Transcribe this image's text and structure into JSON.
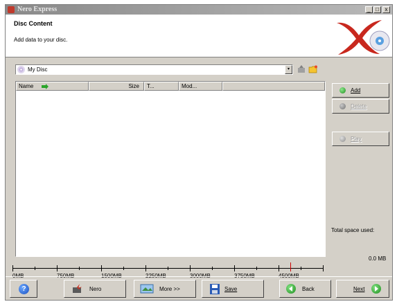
{
  "window": {
    "title": "Nero Express",
    "minimize": "_",
    "maximize": "□",
    "close": "x"
  },
  "header": {
    "title": "Disc Content",
    "subtitle": "Add data to your disc."
  },
  "disc_selector": {
    "value": "My Disc",
    "dropdown_glyph": "▾"
  },
  "file_list": {
    "columns": [
      "Name",
      "Size",
      "T...",
      "Mod..."
    ],
    "rows": []
  },
  "actions": {
    "add": "Add",
    "delete": "Delete",
    "play": "Play"
  },
  "total": {
    "label": "Total space used:",
    "value": "0.0 MB"
  },
  "capacity": {
    "labels": [
      "0MB",
      "750MB",
      "1500MB",
      "2250MB",
      "3000MB",
      "3750MB",
      "4500MB"
    ],
    "used_mb": 0,
    "marker_mb": 4700,
    "max_mb": 5250
  },
  "bottom": {
    "help": "?",
    "nero": "Nero",
    "more": "More >>",
    "save": "Save",
    "back": "Back",
    "next": "Next"
  },
  "colors": {
    "window_bg": "#d4d0c8",
    "titlebar": "#8a8a8a",
    "accent_green": "#1f8f1f",
    "marker_red": "#cc0000"
  }
}
